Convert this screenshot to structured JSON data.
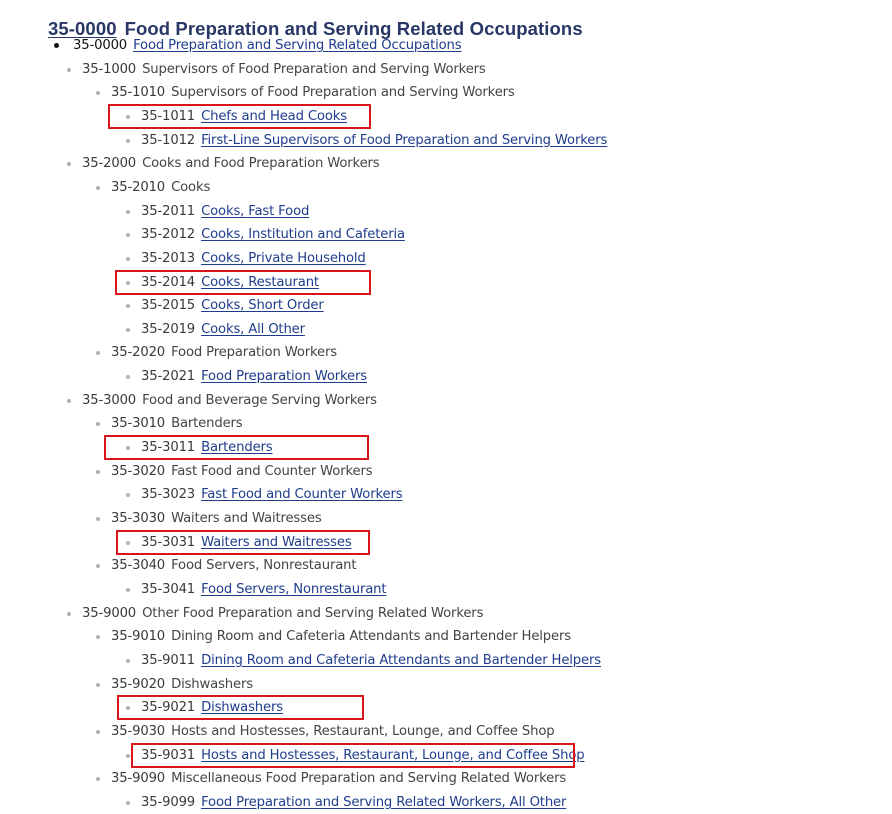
{
  "page": {
    "title_code": "35-0000",
    "title_text": "Food Preparation and Serving Related Occupations"
  },
  "tree": [
    {
      "level": 0,
      "code": "35-0000",
      "label": "Food Preparation and Serving Related Occupations",
      "link": true,
      "highlighted": false
    },
    {
      "level": 1,
      "code": "35-1000",
      "label": "Supervisors of Food Preparation and Serving Workers",
      "link": false,
      "highlighted": false
    },
    {
      "level": 2,
      "code": "35-1010",
      "label": "Supervisors of Food Preparation and Serving Workers",
      "link": false,
      "highlighted": false
    },
    {
      "level": 3,
      "code": "35-1011",
      "label": "Chefs and Head Cooks",
      "link": true,
      "highlighted": true
    },
    {
      "level": 3,
      "code": "35-1012",
      "label": "First-Line Supervisors of Food Preparation and Serving Workers",
      "link": true,
      "highlighted": false
    },
    {
      "level": 1,
      "code": "35-2000",
      "label": "Cooks and Food Preparation Workers",
      "link": false,
      "highlighted": false
    },
    {
      "level": 2,
      "code": "35-2010",
      "label": "Cooks",
      "link": false,
      "highlighted": false
    },
    {
      "level": 3,
      "code": "35-2011",
      "label": "Cooks, Fast Food",
      "link": true,
      "highlighted": false
    },
    {
      "level": 3,
      "code": "35-2012",
      "label": "Cooks, Institution and Cafeteria",
      "link": true,
      "highlighted": false
    },
    {
      "level": 3,
      "code": "35-2013",
      "label": "Cooks, Private Household",
      "link": true,
      "highlighted": false
    },
    {
      "level": 3,
      "code": "35-2014",
      "label": "Cooks, Restaurant",
      "link": true,
      "highlighted": true
    },
    {
      "level": 3,
      "code": "35-2015",
      "label": "Cooks, Short Order",
      "link": true,
      "highlighted": false
    },
    {
      "level": 3,
      "code": "35-2019",
      "label": "Cooks, All Other",
      "link": true,
      "highlighted": false
    },
    {
      "level": 2,
      "code": "35-2020",
      "label": "Food Preparation Workers",
      "link": false,
      "highlighted": false
    },
    {
      "level": 3,
      "code": "35-2021",
      "label": "Food Preparation Workers",
      "link": true,
      "highlighted": false
    },
    {
      "level": 1,
      "code": "35-3000",
      "label": "Food and Beverage Serving Workers",
      "link": false,
      "highlighted": false
    },
    {
      "level": 2,
      "code": "35-3010",
      "label": "Bartenders",
      "link": false,
      "highlighted": false
    },
    {
      "level": 3,
      "code": "35-3011",
      "label": "Bartenders",
      "link": true,
      "highlighted": true
    },
    {
      "level": 2,
      "code": "35-3020",
      "label": "Fast Food and Counter Workers",
      "link": false,
      "highlighted": false
    },
    {
      "level": 3,
      "code": "35-3023",
      "label": "Fast Food and Counter Workers",
      "link": true,
      "highlighted": false
    },
    {
      "level": 2,
      "code": "35-3030",
      "label": "Waiters and Waitresses",
      "link": false,
      "highlighted": false
    },
    {
      "level": 3,
      "code": "35-3031",
      "label": "Waiters and Waitresses",
      "link": true,
      "highlighted": true
    },
    {
      "level": 2,
      "code": "35-3040",
      "label": "Food Servers, Nonrestaurant",
      "link": false,
      "highlighted": false
    },
    {
      "level": 3,
      "code": "35-3041",
      "label": "Food Servers, Nonrestaurant",
      "link": true,
      "highlighted": false
    },
    {
      "level": 1,
      "code": "35-9000",
      "label": "Other Food Preparation and Serving Related Workers",
      "link": false,
      "highlighted": false
    },
    {
      "level": 2,
      "code": "35-9010",
      "label": "Dining Room and Cafeteria Attendants and Bartender Helpers",
      "link": false,
      "highlighted": false
    },
    {
      "level": 3,
      "code": "35-9011",
      "label": "Dining Room and Cafeteria Attendants and Bartender Helpers",
      "link": true,
      "highlighted": false
    },
    {
      "level": 2,
      "code": "35-9020",
      "label": "Dishwashers",
      "link": false,
      "highlighted": false
    },
    {
      "level": 3,
      "code": "35-9021",
      "label": "Dishwashers",
      "link": true,
      "highlighted": true
    },
    {
      "level": 2,
      "code": "35-9030",
      "label": "Hosts and Hostesses, Restaurant, Lounge, and Coffee Shop",
      "link": false,
      "highlighted": false
    },
    {
      "level": 3,
      "code": "35-9031",
      "label": "Hosts and Hostesses, Restaurant, Lounge, and Coffee Shop",
      "link": true,
      "highlighted": true
    },
    {
      "level": 2,
      "code": "35-9090",
      "label": "Miscellaneous Food Preparation and Serving Related Workers",
      "link": false,
      "highlighted": false
    },
    {
      "level": 3,
      "code": "35-9099",
      "label": "Food Preparation and Serving Related Workers, All Other",
      "link": true,
      "highlighted": false
    }
  ],
  "colors": {
    "title": "#283766",
    "link": "#1f3d8c",
    "text": "#444444",
    "highlight_border": "#d9151b"
  }
}
